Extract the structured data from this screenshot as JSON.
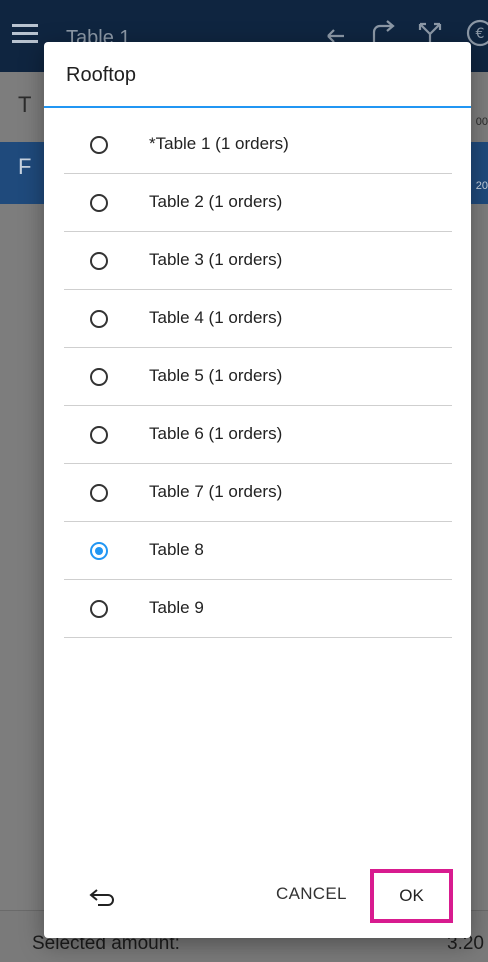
{
  "app": {
    "title": "Table 1",
    "row1_left": "T",
    "row1_right": "00",
    "row2_left": "F",
    "row2_right": "20",
    "bottom_label": "Selected amount:",
    "bottom_amount": "3.20"
  },
  "dialog": {
    "title": "Rooftop",
    "items": [
      {
        "label": "*Table 1 (1 orders)",
        "selected": false
      },
      {
        "label": "Table 2 (1 orders)",
        "selected": false
      },
      {
        "label": "Table 3 (1 orders)",
        "selected": false
      },
      {
        "label": "Table 4 (1 orders)",
        "selected": false
      },
      {
        "label": "Table 5 (1 orders)",
        "selected": false
      },
      {
        "label": "Table 6 (1 orders)",
        "selected": false
      },
      {
        "label": "Table 7 (1 orders)",
        "selected": false
      },
      {
        "label": "Table 8",
        "selected": true
      },
      {
        "label": "Table 9",
        "selected": false
      }
    ],
    "cancel_label": "CANCEL",
    "ok_label": "OK"
  },
  "colors": {
    "accent": "#2196f3",
    "highlight": "#d81b8f",
    "appbar": "#0f2540"
  },
  "icons": {
    "menu": "hamburger-icon",
    "undo": "undo-icon",
    "share": "share-icon",
    "split": "split-icon",
    "currency": "euro-icon",
    "back": "back-arrow-icon"
  }
}
